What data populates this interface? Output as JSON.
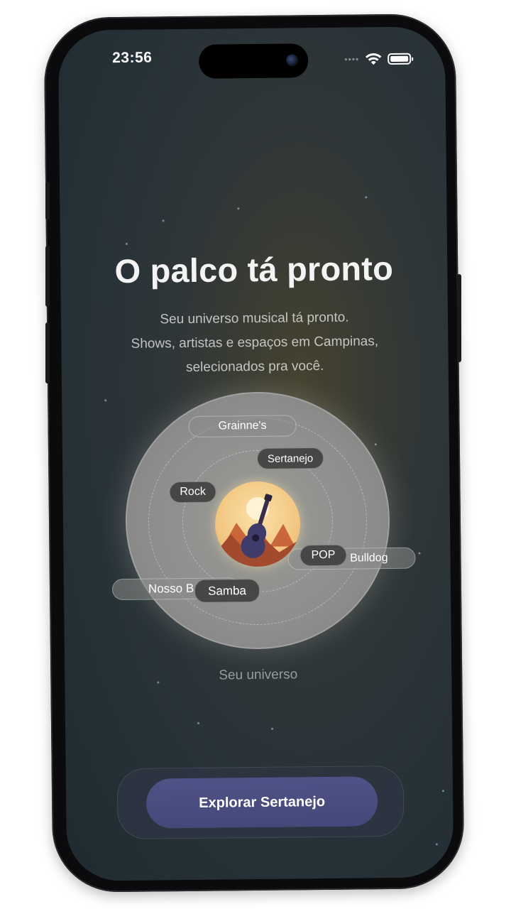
{
  "status_bar": {
    "time": "23:56",
    "icons": [
      "signal-dots-icon",
      "wifi-icon",
      "battery-icon"
    ]
  },
  "hero": {
    "title": "O palco tá pronto",
    "subtitle_lines": [
      "Seu universo musical tá pronto.",
      "Shows, artistas e espaços em Campinas,",
      "selecionados pra você."
    ]
  },
  "universe": {
    "center_icon": "guitar-landscape-icon",
    "chips": {
      "grainnes": "Grainne's",
      "sertanejo": "Sertanejo",
      "rock": "Rock",
      "pop": "POP",
      "bulldog": "Bulldog",
      "nosso": "Nosso B",
      "samba": "Samba"
    },
    "caption": "Seu universo"
  },
  "cta": {
    "label": "Explorar Sertanejo",
    "accent": "#4a4e80"
  }
}
